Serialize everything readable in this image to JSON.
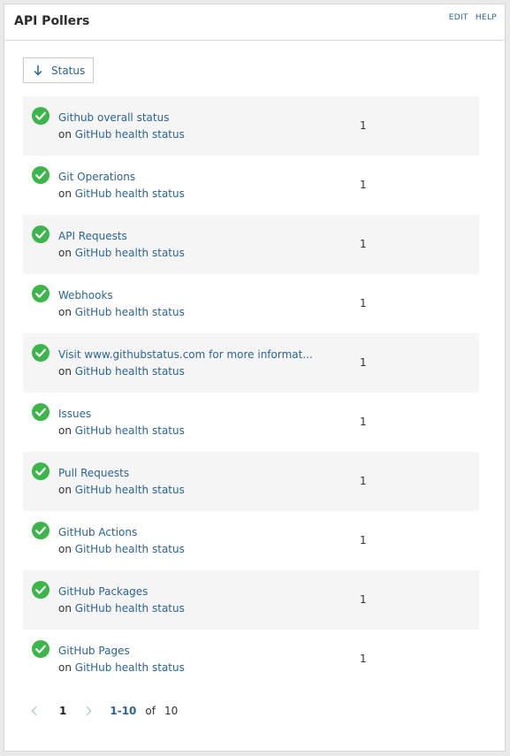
{
  "header": {
    "title": "API Pollers",
    "edit_label": "EDIT",
    "help_label": "HELP"
  },
  "sort": {
    "label": "Status",
    "icon": "arrow-down-icon"
  },
  "rows": [
    {
      "title": "Github overall status",
      "prefix": "on",
      "source": "GitHub health status",
      "count": "1",
      "status": "ok"
    },
    {
      "title": "Git Operations",
      "prefix": "on",
      "source": "GitHub health status",
      "count": "1",
      "status": "ok"
    },
    {
      "title": "API Requests",
      "prefix": "on",
      "source": "GitHub health status",
      "count": "1",
      "status": "ok"
    },
    {
      "title": "Webhooks",
      "prefix": "on",
      "source": "GitHub health status",
      "count": "1",
      "status": "ok"
    },
    {
      "title": "Visit www.githubstatus.com for more informat...",
      "prefix": "on",
      "source": "GitHub health status",
      "count": "1",
      "status": "ok"
    },
    {
      "title": "Issues",
      "prefix": "on",
      "source": "GitHub health status",
      "count": "1",
      "status": "ok"
    },
    {
      "title": "Pull Requests",
      "prefix": "on",
      "source": "GitHub health status",
      "count": "1",
      "status": "ok"
    },
    {
      "title": "GitHub Actions",
      "prefix": "on",
      "source": "GitHub health status",
      "count": "1",
      "status": "ok"
    },
    {
      "title": "GitHub Packages",
      "prefix": "on",
      "source": "GitHub health status",
      "count": "1",
      "status": "ok"
    },
    {
      "title": "GitHub Pages",
      "prefix": "on",
      "source": "GitHub health status",
      "count": "1",
      "status": "ok"
    }
  ],
  "pagination": {
    "current_page": "1",
    "range": "1-10",
    "of_label": "of",
    "total": "10"
  },
  "colors": {
    "accent": "#2a6496",
    "ok_green": "#3cb54a",
    "row_shade": "#f5f5f5"
  }
}
